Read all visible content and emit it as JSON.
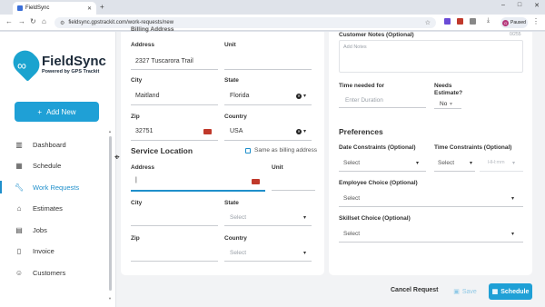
{
  "browser": {
    "tab_title": "FieldSync",
    "url": "fieldsync.gpstrackit.com/work-requests/new",
    "profile_initial": "G",
    "profile_status": "Paused"
  },
  "sidebar": {
    "logo_name": "FieldSync",
    "logo_sub": "Powered by GPS Trackit",
    "add_new": "Add New",
    "items": [
      {
        "label": "Dashboard"
      },
      {
        "label": "Schedule"
      },
      {
        "label": "Work Requests"
      },
      {
        "label": "Estimates"
      },
      {
        "label": "Jobs"
      },
      {
        "label": "Invoice"
      },
      {
        "label": "Customers"
      }
    ]
  },
  "billing": {
    "header_partial": "Billing Address",
    "address_label": "Address",
    "address_value": "2327 Tuscarora Trail",
    "unit_label": "Unit",
    "city_label": "City",
    "city_value": "Maitland",
    "state_label": "State",
    "state_value": "Florida",
    "zip_label": "Zip",
    "zip_value": "32751",
    "country_label": "Country",
    "country_value": "USA"
  },
  "service": {
    "title": "Service Location",
    "same_as_billing": "Same as billing address",
    "address_label": "Address",
    "unit_label": "Unit",
    "city_label": "City",
    "state_label": "State",
    "state_placeholder": "Select",
    "zip_label": "Zip",
    "country_label": "Country",
    "country_placeholder": "Select"
  },
  "right": {
    "customer_notes_label": "Customer Notes (Optional)",
    "customer_notes_counter": "0/255",
    "customer_notes_placeholder": "Add Notes",
    "time_needed_label": "Time needed for",
    "time_needed_placeholder": "Enter Duration",
    "needs_estimate_label_1": "Needs",
    "needs_estimate_label_2": "Estimate?",
    "needs_estimate_value": "No",
    "preferences_title": "Preferences",
    "date_constraints_label": "Date Constraints (Optional)",
    "date_constraints_placeholder": "Select",
    "time_constraints_label": "Time Constraints (Optional)",
    "time_constraints_placeholder": "Select",
    "time_constraints_time": "HH:mm",
    "employee_choice_label": "Employee Choice (Optional)",
    "employee_choice_placeholder": "Select",
    "skillset_choice_label": "Skillset Choice (Optional)",
    "skillset_choice_placeholder": "Select"
  },
  "footer": {
    "cancel": "Cancel Request",
    "save": "Save",
    "schedule": "Schedule"
  }
}
